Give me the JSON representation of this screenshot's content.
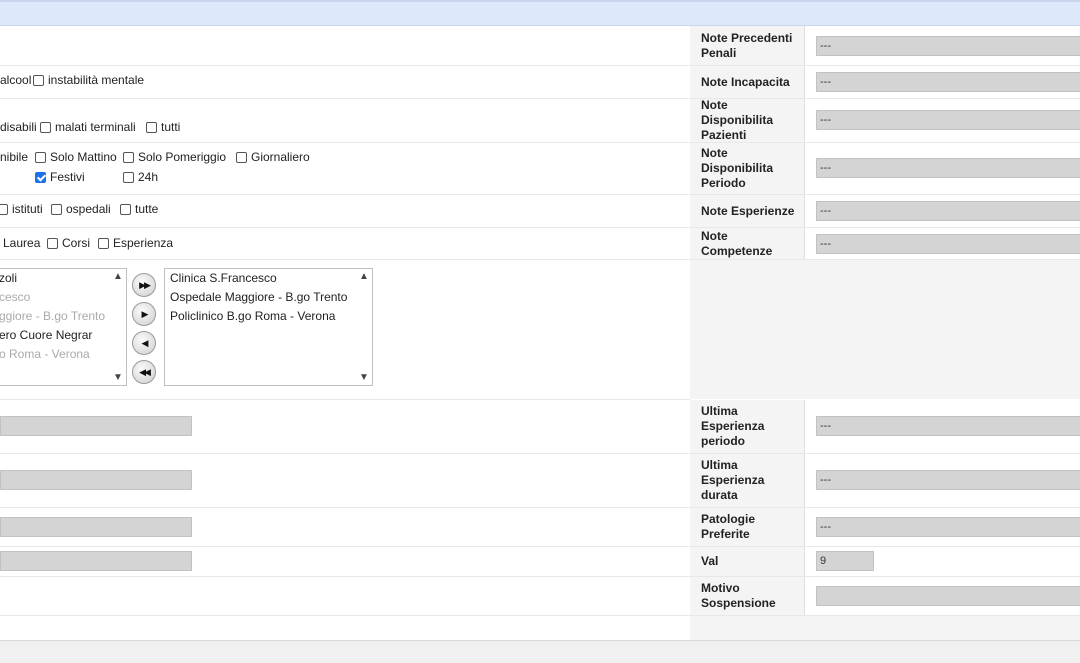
{
  "left": {
    "row1": {
      "opt_alcool": "alcool",
      "opt_instabilita": "instabilità  mentale"
    },
    "row2": {
      "opt_disabili": "disabili",
      "opt_malati": "malati terminali",
      "opt_tutti": "tutti"
    },
    "row3": {
      "prefix": "nibile",
      "opt_mattino": "Solo Mattino",
      "opt_pomeriggio": "Solo Pomeriggio",
      "opt_giornaliero": "Giornaliero",
      "opt_festivi": "Festivi",
      "opt_24h": "24h"
    },
    "row4": {
      "opt_istituti": "istituti",
      "opt_ospedali": "ospedali",
      "opt_tutte": "tutte"
    },
    "row5": {
      "opt_laurea": "Laurea",
      "opt_corsi": "Corsi",
      "opt_esperienza": "Esperienza"
    },
    "available_list": [
      "zoli",
      "cesco",
      "ggiore - B.go Trento",
      "ero Cuore Negrar",
      "o Roma - Verona"
    ],
    "selected_list": [
      "Clinica S.Francesco",
      "Ospedale Maggiore - B.go Trento",
      "Policlinico B.go Roma - Verona"
    ]
  },
  "right": {
    "rows": [
      {
        "label": "Note Precedenti Penali",
        "value": "---"
      },
      {
        "label": "Note Incapacita",
        "value": "---"
      },
      {
        "label": "Note Disponibilita Pazienti",
        "value": "---"
      },
      {
        "label": "Note Disponibilita Periodo",
        "value": "---"
      },
      {
        "label": "Note Esperienze",
        "value": "---"
      },
      {
        "label": "Note Competenze",
        "value": "---"
      },
      {
        "label": "Ultima Esperienza periodo",
        "value": "---"
      },
      {
        "label": "Ultima Esperienza durata",
        "value": "---"
      },
      {
        "label": "Patologie Preferite",
        "value": "---"
      },
      {
        "label": "Val",
        "value": "9"
      },
      {
        "label": "Motivo Sospensione",
        "value": ""
      }
    ]
  }
}
